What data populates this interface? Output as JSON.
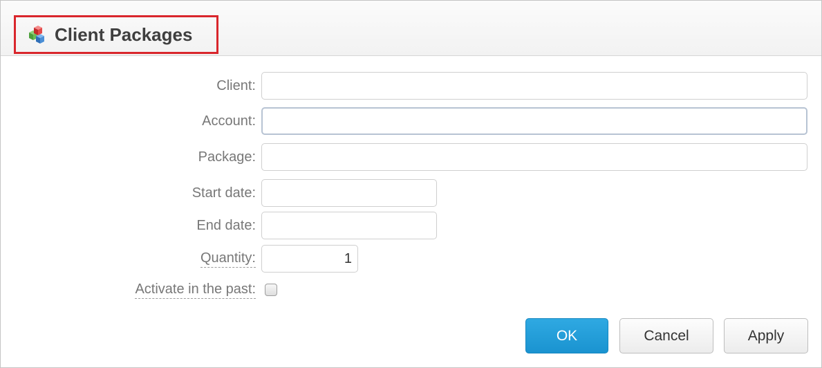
{
  "dialog": {
    "title": "Client Packages",
    "title_icon": "packages-cubes-icon"
  },
  "form": {
    "client": {
      "label": "Client:",
      "value": ""
    },
    "account": {
      "label": "Account:",
      "value": ""
    },
    "package": {
      "label": "Package:",
      "value": ""
    },
    "start_date": {
      "label": "Start date:",
      "value": ""
    },
    "end_date": {
      "label": "End date:",
      "value": ""
    },
    "quantity": {
      "label": "Quantity:",
      "value": "1"
    },
    "activate_in_past": {
      "label": "Activate in the past:",
      "checked": false
    }
  },
  "buttons": {
    "ok": "OK",
    "cancel": "Cancel",
    "apply": "Apply"
  },
  "colors": {
    "title_highlight": "#d9262c",
    "primary_button": "#1a93d0"
  }
}
